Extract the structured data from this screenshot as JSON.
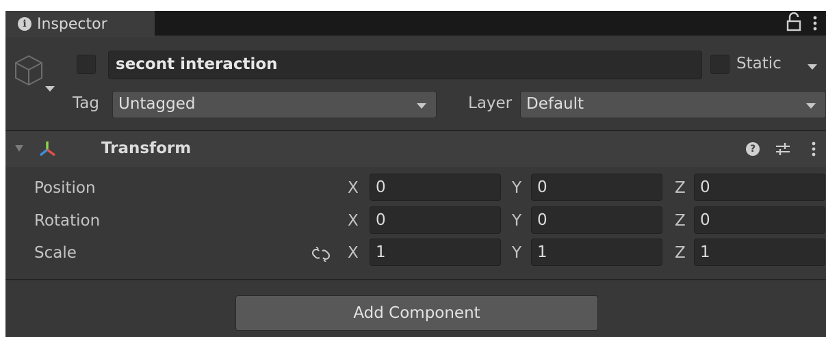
{
  "window": {
    "tab_title": "Inspector"
  },
  "header": {
    "active": false,
    "name": "secont interaction",
    "static_label": "Static",
    "static_checked": false,
    "tag_label": "Tag",
    "tag_value": "Untagged",
    "layer_label": "Layer",
    "layer_value": "Default"
  },
  "transform": {
    "title": "Transform",
    "rows": [
      {
        "label": "Position",
        "x": "0",
        "y": "0",
        "z": "0"
      },
      {
        "label": "Rotation",
        "x": "0",
        "y": "0",
        "z": "0"
      },
      {
        "label": "Scale",
        "x": "1",
        "y": "1",
        "z": "1"
      }
    ],
    "axes": {
      "x": "X",
      "y": "Y",
      "z": "Z"
    }
  },
  "add_component_label": "Add Component",
  "colors": {
    "panel_bg": "#383838",
    "tab_bar_bg": "#191919",
    "field_bg": "#2a2a2a",
    "dropdown_bg": "#515151",
    "button_bg": "#585858"
  },
  "icons": [
    "info-icon",
    "lock-icon",
    "kebab-menu-icon",
    "cube-icon",
    "transform-axis-icon",
    "help-icon",
    "presets-icon",
    "unlink-scale-icon"
  ]
}
